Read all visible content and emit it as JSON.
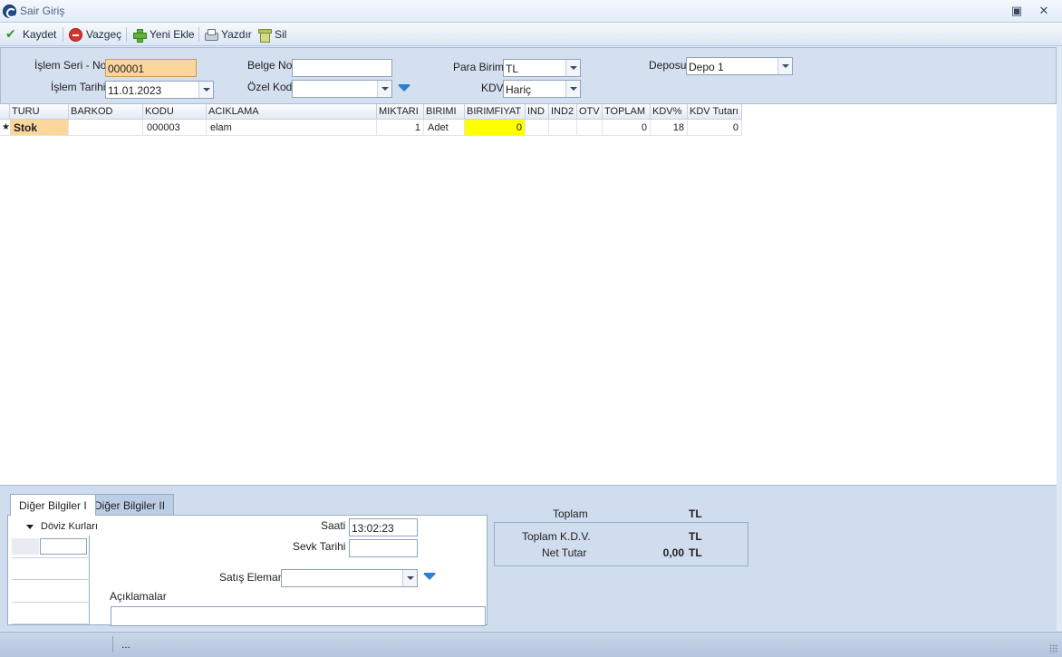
{
  "window": {
    "title": "Sair Giriş"
  },
  "toolbar": {
    "save": "Kaydet",
    "cancel": "Vazgeç",
    "add_new": "Yeni Ekle",
    "print": "Yazdır",
    "delete": "Sil"
  },
  "header": {
    "islem_seri_no_label": "İşlem  Seri - No",
    "islem_seri_no_value": "000001",
    "islem_tarihi_label": "İşlem Tarihi",
    "islem_tarihi_value": "11.01.2023",
    "belge_no_label": "Belge No",
    "belge_no_value": "",
    "ozel_kod_label": "Özel Kod",
    "ozel_kod_value": "",
    "para_birimi_label": "Para Birimi",
    "para_birimi_value": "TL",
    "kdv_label": "KDV",
    "kdv_value": "Hariç",
    "deposu_label": "Deposu",
    "deposu_value": "Depo 1"
  },
  "grid": {
    "columns": [
      "TURU",
      "BARKOD",
      "KODU",
      "ACIKLAMA",
      "MIKTARI",
      "BIRIMI",
      "BIRIMFIYAT",
      "IND",
      "IND2",
      "OTV",
      "TOPLAM",
      "KDV%",
      "KDV Tutarı"
    ],
    "row_indicator": "★",
    "rows": [
      [
        "Stok",
        "",
        "000003",
        "elam",
        "1",
        "Adet",
        "0",
        "",
        "",
        "",
        "0",
        "18",
        "0"
      ]
    ]
  },
  "bottom": {
    "tabs": [
      "Diğer Bilgiler I",
      "Diğer Bilgiler II"
    ],
    "doviz_kurlari": "Döviz Kurları",
    "saati_label": "Saati",
    "saati_value": "13:02:23",
    "sevk_tarihi_label": "Sevk Tarihi",
    "sevk_tarihi_value": "",
    "satis_elemani_label": "Satış Elemanı",
    "satis_elemani_value": "",
    "aciklamalar_label": "Açıklamalar",
    "aciklamalar_value": ""
  },
  "summary": {
    "toplam_label": "Toplam",
    "toplam_value": "",
    "toplam_currency": "TL",
    "toplam_kdv_label": "Toplam K.D.V.",
    "toplam_kdv_value": "",
    "toplam_kdv_currency": "TL",
    "net_tutar_label": "Net Tutar",
    "net_tutar_value": "0,00",
    "net_tutar_currency": "TL"
  },
  "status": {
    "text": "..."
  }
}
